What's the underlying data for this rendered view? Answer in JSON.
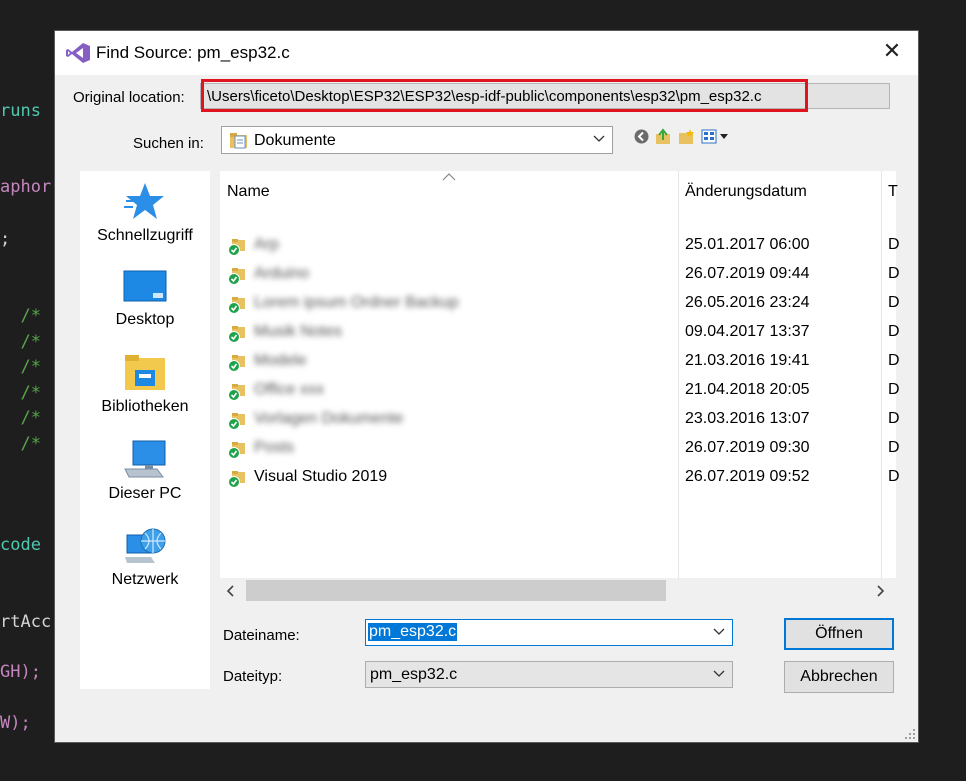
{
  "background_code": {
    "lines": [
      {
        "text": "runs",
        "color": "#4ec9b0"
      },
      {
        "text": "aphor",
        "color": "#c586c0"
      },
      {
        "text": ";",
        "color": "#d4d4d4"
      },
      {
        "text": "  /*",
        "color": "#57a64a"
      },
      {
        "text": "  /*",
        "color": "#57a64a"
      },
      {
        "text": "  /*",
        "color": "#57a64a"
      },
      {
        "text": "  /*",
        "color": "#57a64a"
      },
      {
        "text": "  /*",
        "color": "#57a64a"
      },
      {
        "text": "  /*",
        "color": "#57a64a"
      },
      {
        "text": "code",
        "color": "#4ec9b0"
      },
      {
        "text": "rtAcc",
        "color": "#d4d4d4"
      },
      {
        "text": "GH);",
        "color": "#c586c0"
      },
      {
        "text": "W);",
        "color": "#c586c0"
      }
    ]
  },
  "dialog": {
    "title": "Find Source: pm_esp32.c",
    "close_glyph": "✕",
    "original_location_label": "Original location:",
    "original_location_value": "\\Users\\ficeto\\Desktop\\ESP32\\ESP32\\esp-idf-public\\components\\esp32\\pm_esp32.c",
    "highlight_color": "#e0141e",
    "look_in_label": "Suchen in:",
    "look_in_value": "Dokumente",
    "places": [
      {
        "label": "Schnellzugriff",
        "icon": "star-icon"
      },
      {
        "label": "Desktop",
        "icon": "desktop-icon"
      },
      {
        "label": "Bibliotheken",
        "icon": "libraries-icon"
      },
      {
        "label": "Dieser PC",
        "icon": "computer-icon"
      },
      {
        "label": "Netzwerk",
        "icon": "network-icon"
      }
    ],
    "columns": {
      "name": "Name",
      "date": "Änderungsdatum",
      "type": "T"
    },
    "files": [
      {
        "name": "Arp",
        "date": "25.01.2017 06:00",
        "type": "D",
        "blurred": true
      },
      {
        "name": "Arduino",
        "date": "26.07.2019 09:44",
        "type": "D",
        "blurred": true
      },
      {
        "name": "Lorem ipsum Ordner Backup",
        "date": "26.05.2016 23:24",
        "type": "D",
        "blurred": true
      },
      {
        "name": "Musik Notes",
        "date": "09.04.2017 13:37",
        "type": "D",
        "blurred": true
      },
      {
        "name": "Modele",
        "date": "21.03.2016 19:41",
        "type": "D",
        "blurred": true
      },
      {
        "name": "Office xxx",
        "date": "21.04.2018 20:05",
        "type": "D",
        "blurred": true
      },
      {
        "name": "Vorlagen Dokumente",
        "date": "23.03.2016 13:07",
        "type": "D",
        "blurred": true
      },
      {
        "name": "Posts",
        "date": "26.07.2019 09:30",
        "type": "D",
        "blurred": true
      },
      {
        "name": "Visual Studio 2019",
        "date": "26.07.2019 09:52",
        "type": "D",
        "blurred": false
      }
    ],
    "filename_label": "Dateiname:",
    "filename_value": "pm_esp32.c",
    "filetype_label": "Dateityp:",
    "filetype_value": "pm_esp32.c",
    "open_button": "Öffnen",
    "cancel_button": "Abbrechen",
    "accent_color": "#0078d7"
  }
}
